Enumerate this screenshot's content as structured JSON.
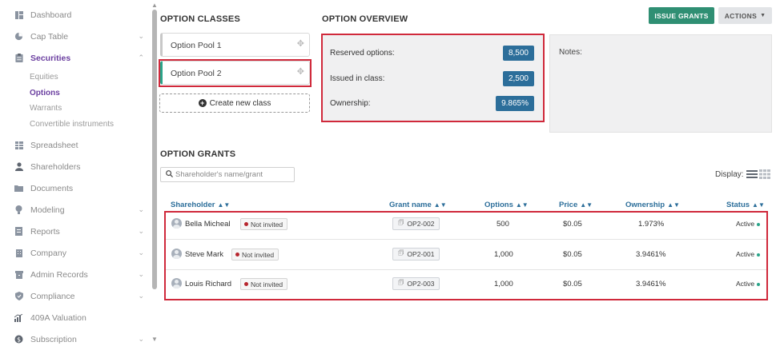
{
  "sidebar": {
    "items": [
      {
        "label": "Dashboard",
        "icon": "dashboard-icon",
        "chevron": false
      },
      {
        "label": "Cap Table",
        "icon": "pie-chart-icon",
        "chevron": true
      },
      {
        "label": "Securities",
        "icon": "clipboard-icon",
        "chevron": true,
        "active": true
      },
      {
        "label": "Spreadsheet",
        "icon": "table-icon",
        "chevron": false
      },
      {
        "label": "Shareholders",
        "icon": "user-icon",
        "chevron": false
      },
      {
        "label": "Documents",
        "icon": "folder-icon",
        "chevron": false
      },
      {
        "label": "Modeling",
        "icon": "lightbulb-icon",
        "chevron": true
      },
      {
        "label": "Reports",
        "icon": "report-icon",
        "chevron": true
      },
      {
        "label": "Company",
        "icon": "building-icon",
        "chevron": true
      },
      {
        "label": "Admin Records",
        "icon": "archive-icon",
        "chevron": true
      },
      {
        "label": "Compliance",
        "icon": "shield-check-icon",
        "chevron": true
      },
      {
        "label": "409A Valuation",
        "icon": "chart-up-icon",
        "chevron": false
      },
      {
        "label": "Subscription",
        "icon": "dollar-icon",
        "chevron": true
      }
    ],
    "sub_items": [
      "Equities",
      "Options",
      "Warrants",
      "Convertible instruments"
    ]
  },
  "option_classes": {
    "title": "OPTION CLASSES",
    "pools": [
      "Option Pool 1",
      "Option Pool 2"
    ],
    "create_label": "Create new class"
  },
  "overview": {
    "title": "OPTION OVERVIEW",
    "rows": [
      {
        "label": "Reserved options:",
        "value": "8,500"
      },
      {
        "label": "Issued in class:",
        "value": "2,500"
      },
      {
        "label": "Ownership:",
        "value": "9.865%"
      }
    ],
    "notes_label": "Notes:"
  },
  "actions": {
    "issue_label": "ISSUE GRANTS",
    "actions_label": "ACTIONS"
  },
  "grants": {
    "title": "OPTION GRANTS",
    "search_placeholder": "Shareholder's name/grant",
    "display_label": "Display:",
    "columns": [
      "Shareholder",
      "Grant name",
      "Options",
      "Price",
      "Ownership",
      "Status"
    ],
    "rows": [
      {
        "shareholder": "Bella Micheal",
        "invite": "Not invited",
        "grant": "OP2-002",
        "options": "500",
        "price": "$0.05",
        "ownership": "1.973%",
        "status": "Active"
      },
      {
        "shareholder": "Steve Mark",
        "invite": "Not invited",
        "grant": "OP2-001",
        "options": "1,000",
        "price": "$0.05",
        "ownership": "3.9461%",
        "status": "Active"
      },
      {
        "shareholder": "Louis Richard",
        "invite": "Not invited",
        "grant": "OP2-003",
        "options": "1,000",
        "price": "$0.05",
        "ownership": "3.9461%",
        "status": "Active"
      }
    ]
  },
  "colors": {
    "accent_purple": "#6b3fa0",
    "badge_blue": "#2c6e9a",
    "issue_green": "#2f8f73",
    "highlight_red": "#d0293b",
    "status_green": "#2aa58a",
    "not_invited_red": "#b7262e"
  }
}
